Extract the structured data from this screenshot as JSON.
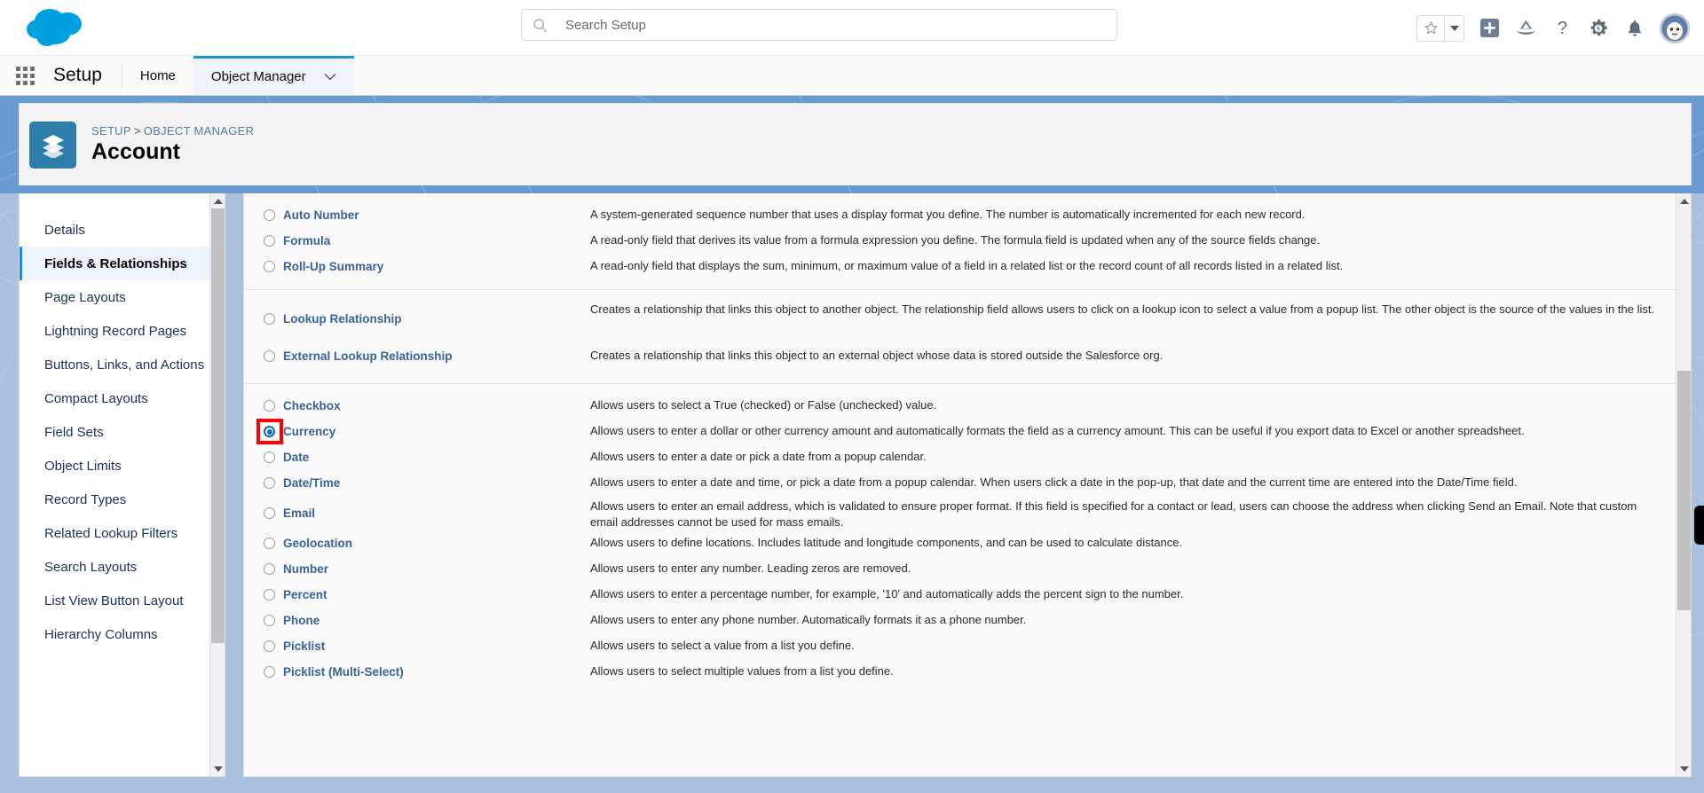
{
  "header": {
    "logo_icon": "salesforce-cloud-logo",
    "search": {
      "placeholder": "Search Setup",
      "value": "",
      "icon": "search-icon"
    },
    "icons": [
      {
        "name": "favorites-star-icon",
        "glyph": "star"
      },
      {
        "name": "favorites-dropdown-icon",
        "glyph": "caret-down"
      },
      {
        "name": "add-icon",
        "glyph": "plus-square"
      },
      {
        "name": "trailhead-icon",
        "glyph": "mountain"
      },
      {
        "name": "help-icon",
        "glyph": "question-mark"
      },
      {
        "name": "setup-gear-icon",
        "glyph": "gear"
      },
      {
        "name": "notifications-bell-icon",
        "glyph": "bell"
      },
      {
        "name": "user-avatar",
        "glyph": "astro-avatar"
      }
    ]
  },
  "setup_nav": {
    "app_launcher_label": "App Launcher",
    "title": "Setup",
    "tabs": [
      {
        "label": "Home",
        "active": false,
        "has_caret": false
      },
      {
        "label": "Object Manager",
        "active": true,
        "has_caret": true
      }
    ]
  },
  "record_header": {
    "icon": "object-layers-icon",
    "breadcrumb": {
      "setup": "SETUP",
      "separator": ">",
      "object_manager": "OBJECT MANAGER"
    },
    "title": "Account"
  },
  "sidebar": {
    "items": [
      {
        "label": "Details",
        "active": false
      },
      {
        "label": "Fields & Relationships",
        "active": true
      },
      {
        "label": "Page Layouts",
        "active": false
      },
      {
        "label": "Lightning Record Pages",
        "active": false
      },
      {
        "label": "Buttons, Links, and Actions",
        "active": false
      },
      {
        "label": "Compact Layouts",
        "active": false
      },
      {
        "label": "Field Sets",
        "active": false
      },
      {
        "label": "Object Limits",
        "active": false
      },
      {
        "label": "Record Types",
        "active": false
      },
      {
        "label": "Related Lookup Filters",
        "active": false
      },
      {
        "label": "Search Layouts",
        "active": false
      },
      {
        "label": "List View Button Layout",
        "active": false
      },
      {
        "label": "Hierarchy Columns",
        "active": false
      }
    ]
  },
  "field_types": {
    "groups": [
      {
        "options": [
          {
            "label": "Auto Number",
            "checked": false,
            "highlighted": false,
            "description": "A system-generated sequence number that uses a display format you define. The number is automatically incremented for each new record."
          },
          {
            "label": "Formula",
            "checked": false,
            "highlighted": false,
            "description": "A read-only field that derives its value from a formula expression you define. The formula field is updated when any of the source fields change."
          },
          {
            "label": "Roll-Up Summary",
            "checked": false,
            "highlighted": false,
            "description": "A read-only field that displays the sum, minimum, or maximum value of a field in a related list or the record count of all records listed in a related list."
          }
        ]
      },
      {
        "options": [
          {
            "label": "Lookup Relationship",
            "checked": false,
            "highlighted": false,
            "description": "Creates a relationship that links this object to another object. The relationship field allows users to click on a lookup icon to select a value from a popup list. The other object is the source of the values in the list."
          },
          {
            "label": "External Lookup Relationship",
            "checked": false,
            "highlighted": false,
            "description": "Creates a relationship that links this object to an external object whose data is stored outside the Salesforce org."
          }
        ]
      },
      {
        "options": [
          {
            "label": "Checkbox",
            "checked": false,
            "highlighted": false,
            "description": "Allows users to select a True (checked) or False (unchecked) value."
          },
          {
            "label": "Currency",
            "checked": true,
            "highlighted": true,
            "description": "Allows users to enter a dollar or other currency amount and automatically formats the field as a currency amount. This can be useful if you export data to Excel or another spreadsheet."
          },
          {
            "label": "Date",
            "checked": false,
            "highlighted": false,
            "description": "Allows users to enter a date or pick a date from a popup calendar."
          },
          {
            "label": "Date/Time",
            "checked": false,
            "highlighted": false,
            "description": "Allows users to enter a date and time, or pick a date from a popup calendar. When users click a date in the pop-up, that date and the current time are entered into the Date/Time field."
          },
          {
            "label": "Email",
            "checked": false,
            "highlighted": false,
            "description": "Allows users to enter an email address, which is validated to ensure proper format. If this field is specified for a contact or lead, users can choose the address when clicking Send an Email. Note that custom email addresses cannot be used for mass emails."
          },
          {
            "label": "Geolocation",
            "checked": false,
            "highlighted": false,
            "description": "Allows users to define locations. Includes latitude and longitude components, and can be used to calculate distance."
          },
          {
            "label": "Number",
            "checked": false,
            "highlighted": false,
            "description": "Allows users to enter any number. Leading zeros are removed."
          },
          {
            "label": "Percent",
            "checked": false,
            "highlighted": false,
            "description": "Allows users to enter a percentage number, for example, '10' and automatically adds the percent sign to the number."
          },
          {
            "label": "Phone",
            "checked": false,
            "highlighted": false,
            "description": "Allows users to enter any phone number. Automatically formats it as a phone number."
          },
          {
            "label": "Picklist",
            "checked": false,
            "highlighted": false,
            "description": "Allows users to select a value from a list you define."
          },
          {
            "label": "Picklist (Multi-Select)",
            "checked": false,
            "highlighted": false,
            "description": "Allows users to select multiple values from a list you define."
          }
        ]
      }
    ]
  },
  "colors": {
    "brand_blue": "#1589ee",
    "banner_blue": "#a9c1de",
    "link_blue": "#39639c",
    "highlight_red": "#ff0000",
    "selected_radio": "#1167c4",
    "tab_active_border": "#1b96c8"
  }
}
